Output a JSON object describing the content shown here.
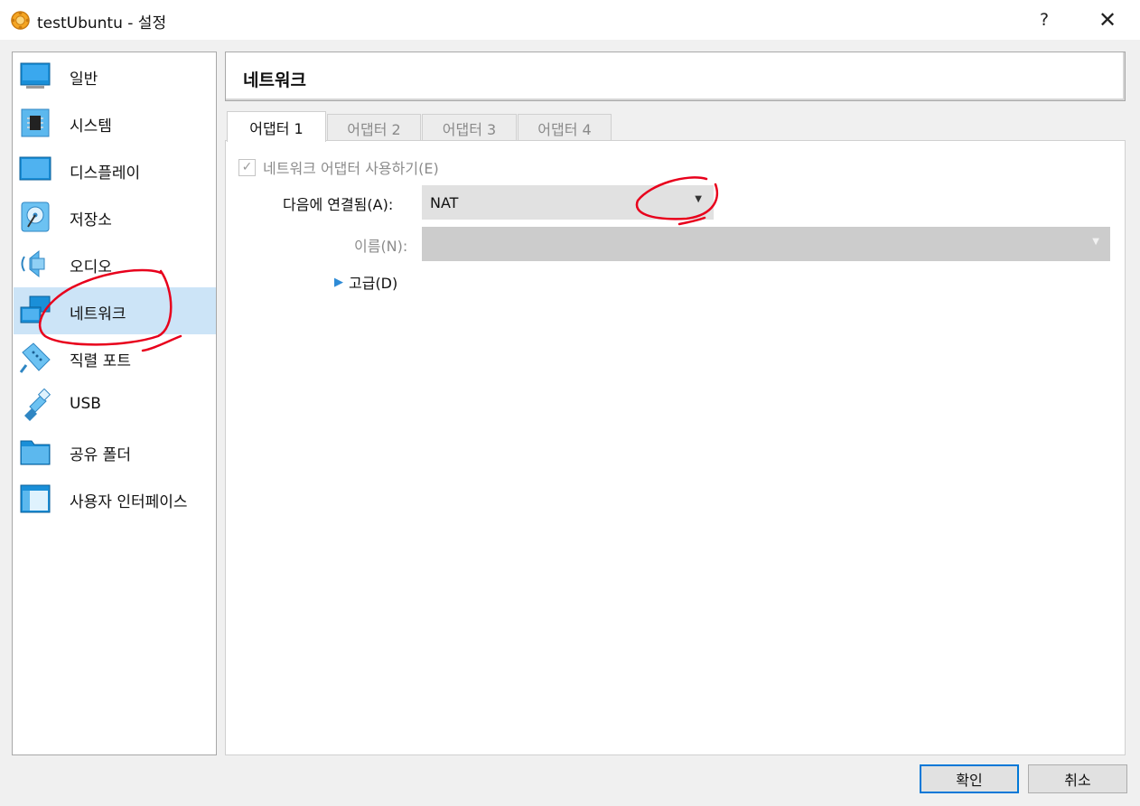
{
  "window": {
    "title": "testUbuntu - 설정",
    "help": "?",
    "close": "✕"
  },
  "sidebar": {
    "items": [
      {
        "label": "일반",
        "icon": "general-icon"
      },
      {
        "label": "시스템",
        "icon": "system-chip-icon"
      },
      {
        "label": "디스플레이",
        "icon": "display-monitor-icon"
      },
      {
        "label": "저장소",
        "icon": "storage-disk-icon"
      },
      {
        "label": "오디오",
        "icon": "audio-speaker-icon"
      },
      {
        "label": "네트워크",
        "icon": "network-icon"
      },
      {
        "label": "직렬 포트",
        "icon": "serial-port-icon"
      },
      {
        "label": "USB",
        "icon": "usb-icon"
      },
      {
        "label": "공유 폴더",
        "icon": "shared-folder-icon"
      },
      {
        "label": "사용자 인터페이스",
        "icon": "user-interface-icon"
      }
    ],
    "selected": "네트워크"
  },
  "header": {
    "title": "네트워크"
  },
  "tabs": [
    {
      "label": "어댑터 1",
      "active": true
    },
    {
      "label": "어댑터 2",
      "active": false
    },
    {
      "label": "어댑터 3",
      "active": false
    },
    {
      "label": "어댑터 4",
      "active": false
    }
  ],
  "form": {
    "enable_label": "네트워크 어댑터 사용하기(E)",
    "enable_checked": true,
    "attached_label": "다음에 연결됨(A):",
    "attached_value": "NAT",
    "name_label": "이름(N):",
    "name_value": "",
    "advanced_label": "고급(D)"
  },
  "buttons": {
    "ok": "확인",
    "cancel": "취소"
  },
  "colors": {
    "accent": "#0078d7",
    "selection": "#cce4f7",
    "annotation": "#e8001c"
  }
}
